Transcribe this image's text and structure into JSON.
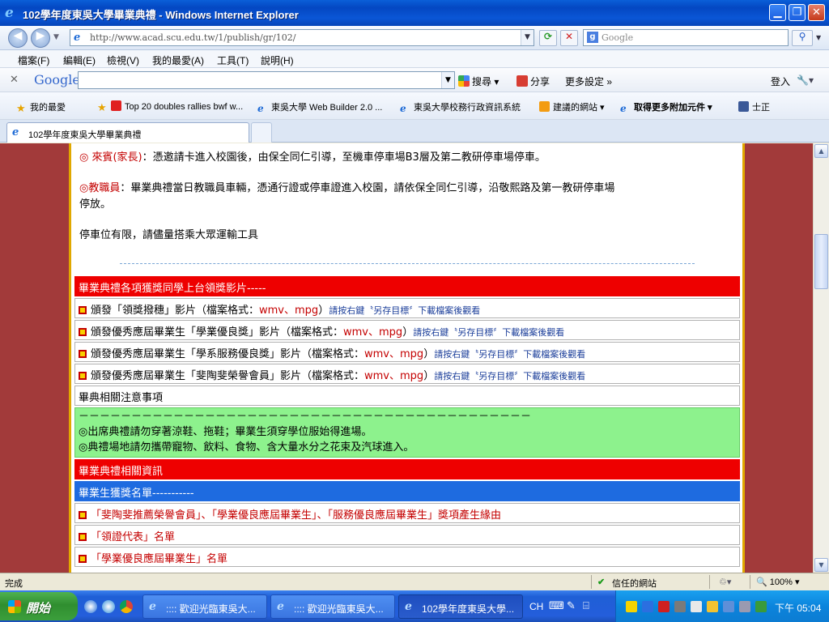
{
  "window": {
    "title": "102學年度東吳大學畢業典禮 - Windows Internet Explorer"
  },
  "address_bar": {
    "url": "http://www.acad.scu.edu.tw/1/publish/gr/102/",
    "search_placeholder": "Google"
  },
  "menu": {
    "items": [
      "檔案(F)",
      "編輯(E)",
      "檢視(V)",
      "我的最愛(A)",
      "工具(T)",
      "說明(H)"
    ]
  },
  "google_toolbar": {
    "logo": "Google",
    "search_label": "搜尋",
    "share_label": "分享",
    "more_settings_label": "更多設定 »",
    "signin_label": "登入"
  },
  "favorites": {
    "items": [
      "我的最愛",
      "Top 20 doubles rallies bwf w...",
      "東吳大學 Web Builder 2.0 ...",
      "東吳大學校務行政資訊系統",
      "建議的網站 ▾",
      "取得更多附加元件 ▾",
      "士正"
    ]
  },
  "tab": {
    "label": "102學年度東吳大學畢業典禮"
  },
  "content": {
    "guests_label": "◎ 來賓(家長)",
    "guests_text": "：憑邀請卡進入校園後，由保全同仁引導，至機車停車場B3層及第二教研停車場停車。",
    "staff_label": "◎教職員",
    "staff_text_1": "：畢業典禮當日教職員車輛，憑通行證或停車證進入校園，請依保全同仁引導，沿敬熙路及第一教研停車場",
    "staff_text_2": "停放。",
    "parking_note": "停車位有限，請儘量搭乘大眾運輸工具",
    "award_videos_header": "畢業典禮各項獲獎同學上台領獎影片-----",
    "award_videos": [
      {
        "label": "頒發「領獎撥穗」影片（檔案格式：",
        "formats": "wmv、mpg",
        "end": "）",
        "note": "請按右鍵〝另存目標〞下載檔案後觀看"
      },
      {
        "label": "頒發優秀應屆畢業生「學業優良獎」影片（檔案格式：",
        "formats": "wmv、mpg",
        "end": "）",
        "note": "請按右鍵〝另存目標〞下載檔案後觀看"
      },
      {
        "label": "頒發優秀應屆畢業生「學系服務優良獎」影片（檔案格式：",
        "formats": "wmv、mpg",
        "end": "）",
        "note": "請按右鍵〝另存目標〞下載檔案後觀看"
      },
      {
        "label": "頒發優秀應屆畢業生「斐陶斐榮譽會員」影片（檔案格式：",
        "formats": "wmv、mpg",
        "end": "）",
        "note": "請按右鍵〝另存目標〞下載檔案後觀看"
      }
    ],
    "notice_header": "畢典相關注意事項",
    "notice_dashes": "－－－－－－－－－－－－－－－－－－－－－－－－－－－－－－－－－－－－－－－－－－－",
    "notice_line_1": "◎出席典禮請勿穿著涼鞋、拖鞋；畢業生須穿學位服始得進場。",
    "notice_line_2": "◎典禮場地請勿攜帶寵物、飲料、食物、含大量水分之花束及汽球進入。",
    "info_header": "畢業典禮相關資訊",
    "award_list_header": "畢業生獲獎名單-----------",
    "award_links": [
      "「斐陶斐推薦榮譽會員」、「學業優良應屆畢業生」、「服務優良應屆畢業生」獎項產生緣由",
      "「領證代表」名單",
      "「學業優良應屆畢業生」名單"
    ]
  },
  "status_bar": {
    "status": "完成",
    "zone": "信任的網站",
    "zoom": "100%"
  },
  "taskbar": {
    "start_label": "開始",
    "tasks": [
      ":::: 歡迎光臨東吳大...",
      ":::: 歡迎光臨東吳大...",
      "102學年度東吳大學..."
    ],
    "language": "CH",
    "clock": "下午 05:04"
  }
}
